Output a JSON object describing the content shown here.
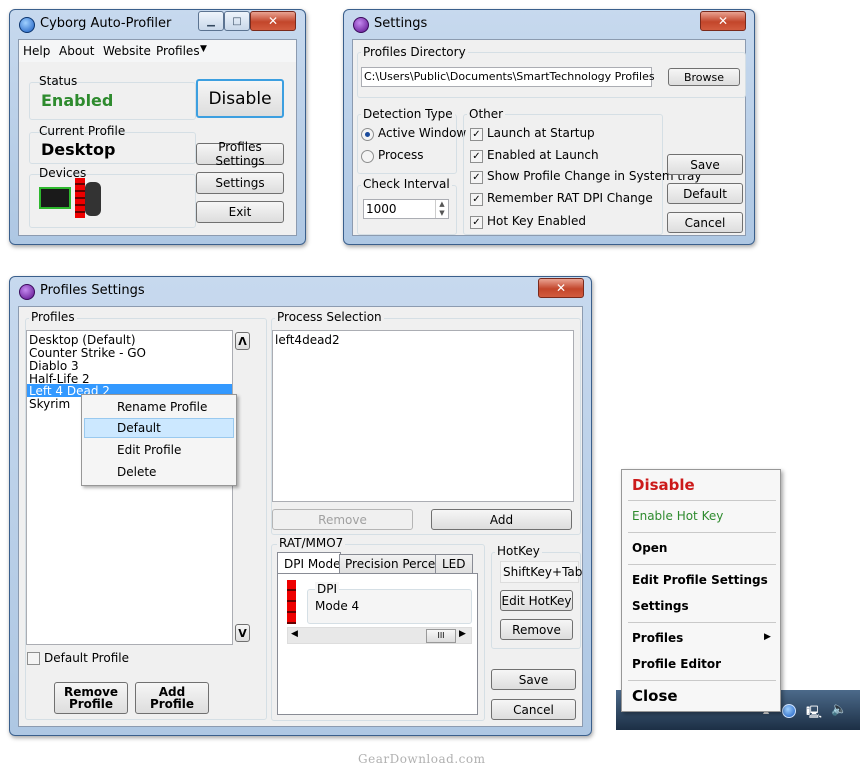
{
  "autoprofiler": {
    "title": "Cyborg Auto-Profiler",
    "menu": [
      "Help",
      "About",
      "Website",
      "Profiles"
    ],
    "status_label": "Status",
    "status_value": "Enabled",
    "disable_button": "Disable",
    "current_profile_label": "Current Profile",
    "current_profile_value": "Desktop",
    "devices_label": "Devices",
    "profiles_settings_button": "Profiles Settings",
    "settings_button": "Settings",
    "exit_button": "Exit"
  },
  "settings": {
    "title": "Settings",
    "profiles_directory_label": "Profiles Directory",
    "profiles_directory_value": "C:\\Users\\Public\\Documents\\SmartTechnology Profiles",
    "browse_button": "Browse",
    "detection_type_label": "Detection Type",
    "detection_options": [
      "Active Window",
      "Process"
    ],
    "check_interval_label": "Check Interval",
    "check_interval_value": "1000",
    "other_label": "Other",
    "other_options": [
      "Launch at Startup",
      "Enabled at Launch",
      "Show Profile Change in System tray",
      "Remember RAT DPI Change",
      "Hot Key Enabled"
    ],
    "save_button": "Save",
    "default_button": "Default",
    "cancel_button": "Cancel"
  },
  "profiles_settings": {
    "title": "Profiles Settings",
    "profiles_label": "Profiles",
    "profiles": [
      "Desktop (Default)",
      "Counter Strike - GO",
      "Diablo 3",
      "Half-Life 2",
      "Left 4 Dead 2",
      "Skyrim"
    ],
    "context_menu": [
      "Rename Profile",
      "Default",
      "Edit Profile",
      "Delete"
    ],
    "default_profile_label": "Default Profile",
    "remove_profile_button": "Remove\nProfile",
    "add_profile_button": "Add\nProfile",
    "process_selection_label": "Process Selection",
    "processes": [
      "left4dead2"
    ],
    "remove_button": "Remove",
    "add_button": "Add",
    "rat_label": "RAT/MMO7",
    "tabs": [
      "DPI Mode",
      "Precision Percent",
      "LED"
    ],
    "dpi_label": "DPI",
    "dpi_value": "Mode 4",
    "scroll_thumb": "III",
    "hotkey_label": "HotKey",
    "hotkey_value": "ShiftKey+Tab",
    "edit_hotkey_button": "Edit HotKey",
    "hotkey_remove_button": "Remove",
    "save_button": "Save",
    "cancel_button": "Cancel"
  },
  "tray_menu": {
    "disable": "Disable",
    "enable_hot_key": "Enable Hot Key",
    "open": "Open",
    "edit_profile_settings": "Edit Profile Settings",
    "settings": "Settings",
    "profiles": "Profiles",
    "profile_editor": "Profile Editor",
    "close": "Close"
  },
  "watermark": "GearDownload.com",
  "colors": {
    "enabled_green": "#2e8b2e",
    "disable_red": "#cc1a1a",
    "hotkey_green": "#2e8b2e",
    "selection_blue": "#3399ff"
  }
}
